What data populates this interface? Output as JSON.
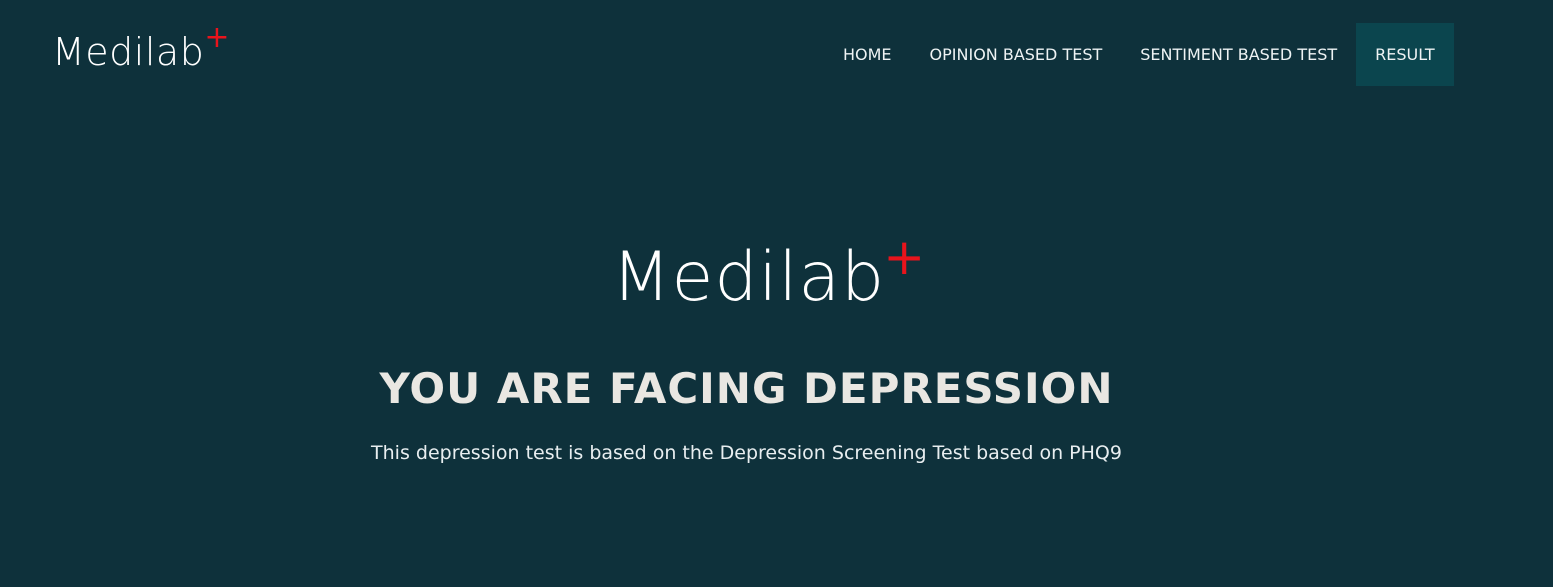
{
  "header": {
    "logo": {
      "text": "Medilab",
      "plus": "+"
    },
    "nav": [
      {
        "label": "HOME",
        "active": false
      },
      {
        "label": "OPINION BASED TEST",
        "active": false
      },
      {
        "label": "SENTIMENT BASED TEST",
        "active": false
      },
      {
        "label": "RESULT",
        "active": true
      }
    ]
  },
  "hero": {
    "logo": {
      "text": "Medilab",
      "plus": "+"
    },
    "title": "YOU ARE FACING DEPRESSION",
    "subtitle": "This depression test is based on the Depression Screening Test based on PHQ9"
  },
  "colors": {
    "background": "#0e313b",
    "active_nav": "#0b454e",
    "accent": "#e8141c"
  }
}
